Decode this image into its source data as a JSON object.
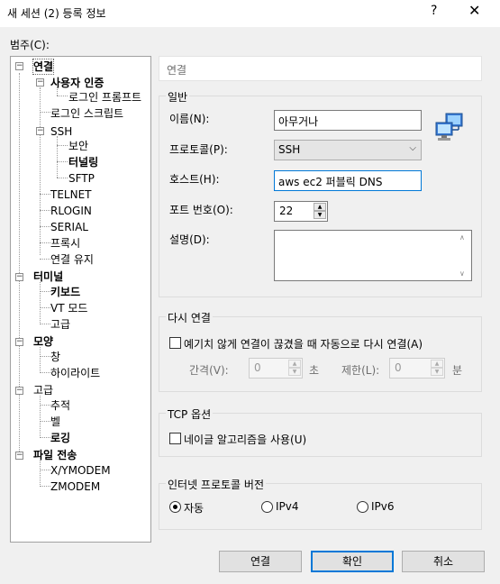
{
  "window": {
    "title": "새 세션 (2) 등록 정보",
    "help": "?",
    "close": "✕"
  },
  "category_label": "범주(C):",
  "tree": {
    "connection": "연결",
    "user_auth": "사용자 인증",
    "login_prompt": "로그인 프롬프트",
    "login_script": "로그인 스크립트",
    "ssh": "SSH",
    "security": "보안",
    "tunneling": "터널링",
    "sftp": "SFTP",
    "telnet": "TELNET",
    "rlogin": "RLOGIN",
    "serial": "SERIAL",
    "proxy": "프록시",
    "keepalive": "연결 유지",
    "terminal": "터미널",
    "keyboard": "키보드",
    "vt_mode": "VT 모드",
    "advanced_t": "고급",
    "appearance": "모양",
    "window": "창",
    "highlight": "하이라이트",
    "advanced": "고급",
    "trace": "추적",
    "bell": "벨",
    "logging": "로깅",
    "file_transfer": "파일 전송",
    "xymodem": "X/YMODEM",
    "zmodem": "ZMODEM"
  },
  "panel_header": "연결",
  "general": {
    "title": "일반",
    "name_label": "이름(N):",
    "name_value": "아무거나",
    "protocol_label": "프로토콜(P):",
    "protocol_value": "SSH",
    "host_label": "호스트(H):",
    "host_value": "aws ec2 퍼블릭 DNS",
    "port_label": "포트 번호(O):",
    "port_value": "22",
    "desc_label": "설명(D):",
    "desc_value": ""
  },
  "reconnect": {
    "title": "다시 연결",
    "checkbox_label": "예기치 않게 연결이 끊겼을 때 자동으로 다시 연결(A)",
    "checked": false,
    "interval_label": "간격(V):",
    "interval_value": "0",
    "interval_unit": "초",
    "limit_label": "제한(L):",
    "limit_value": "0",
    "limit_unit": "분"
  },
  "tcp": {
    "title": "TCP 옵션",
    "nagle_label": "네이글 알고리즘을 사용(U)",
    "checked": false
  },
  "ip_version": {
    "title": "인터넷 프로토콜 버전",
    "options": [
      "자동",
      "IPv4",
      "IPv6"
    ],
    "selected": "자동"
  },
  "buttons": {
    "connect": "연결",
    "ok": "확인",
    "cancel": "취소"
  },
  "colors": {
    "accent": "#0078d7",
    "dialog_bg": "#f0f0f0"
  },
  "icons": {
    "close": "close-icon",
    "help": "help-icon",
    "network": "network-computers-icon"
  }
}
